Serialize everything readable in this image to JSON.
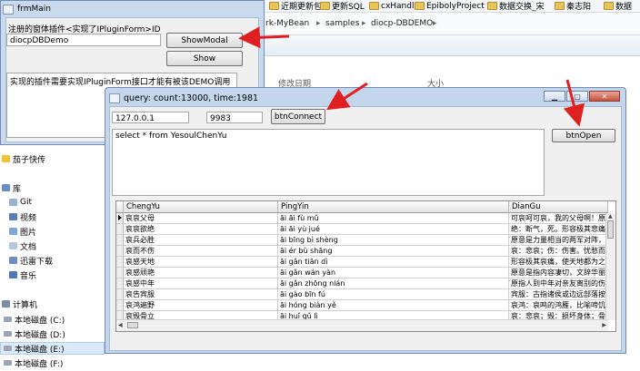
{
  "explorer": {
    "bookmarks": [
      "近期更新包",
      "更新SQL",
      "cxHandle",
      "EpibolyProject",
      "数据交换_宋",
      "秦志阳",
      "数据"
    ],
    "breadcrumb": [
      "rk-MyBean",
      "samples",
      "diocp-DBDEMO"
    ],
    "columns": [
      "修改日期",
      "大小"
    ],
    "nav": {
      "favorites": "茄子快传",
      "library": "库",
      "items": [
        "Git",
        "视频",
        "图片",
        "文档",
        "迅雷下载",
        "音乐"
      ],
      "computer": "计算机",
      "drives": [
        "本地磁盘 (C:)",
        "本地磁盘 (D:)",
        "本地磁盘 (E:)",
        "本地磁盘 (F:)"
      ]
    }
  },
  "frmMain": {
    "title": "frmMain",
    "label": "注册的窗体插件<实现了IPluginForm>ID",
    "id_input": "diocpDBDemo",
    "btn_showmodal": "ShowModal",
    "btn_show": "Show",
    "memo": "实现的插件需要实现IPluginForm接口才能有被该DEMO调用"
  },
  "query": {
    "title": "query: count:13000, time:1981",
    "host": "127.0.0.1",
    "port": "9983",
    "btn_connect": "btnConnect",
    "btn_open": "btnOpen",
    "sql": "select * from YesoulChenYu"
  },
  "grid": {
    "columns": [
      "ChengYu",
      "PingYin",
      "DianGu"
    ],
    "rows": [
      [
        "哀哀父母",
        "āi āi fù mǔ",
        "可哀呵可哀，我的父母啊！原"
      ],
      [
        "哀哀欲绝",
        "āi āi yù jué",
        "绝：断气，死。形容极其悲痛"
      ],
      [
        "哀兵必胜",
        "āi bīng bì shèng",
        "原意是力量相当的两军对阵，"
      ],
      [
        "哀而不伤",
        "āi ér bù shāng",
        "哀：悲哀；伤：伤害。忧愁而"
      ],
      [
        "哀感天地",
        "āi gǎn tiān dì",
        "形容极其哀痛，使天地都为之"
      ],
      [
        "哀感顽艳",
        "āi gǎn wán yàn",
        "原意是指内容凄切，文辞华丽"
      ],
      [
        "哀感中年",
        "āi gǎn zhōng nián",
        "原指人到中年对亲友离别的伤"
      ],
      [
        "哀告宾服",
        "āi gào bīn fú",
        "宾服：古指诸侯或边远部落按"
      ],
      [
        "哀鸿遍野",
        "āi hóng biàn yě",
        "哀鸿：哀鸣的鸿雁，比喻啼饥"
      ],
      [
        "哀毁骨立",
        "āi huǐ gǔ lì",
        "哀：悲哀；毁：损坏身体；骨"
      ]
    ]
  },
  "colors": {
    "arrow": "#e02020",
    "selection": "#dcebfc",
    "title_bar": "#c4d6ec"
  },
  "icons": [
    "app-icon",
    "folder-icon",
    "minimize-icon",
    "maximize-icon",
    "close-icon",
    "drive-icon"
  ]
}
